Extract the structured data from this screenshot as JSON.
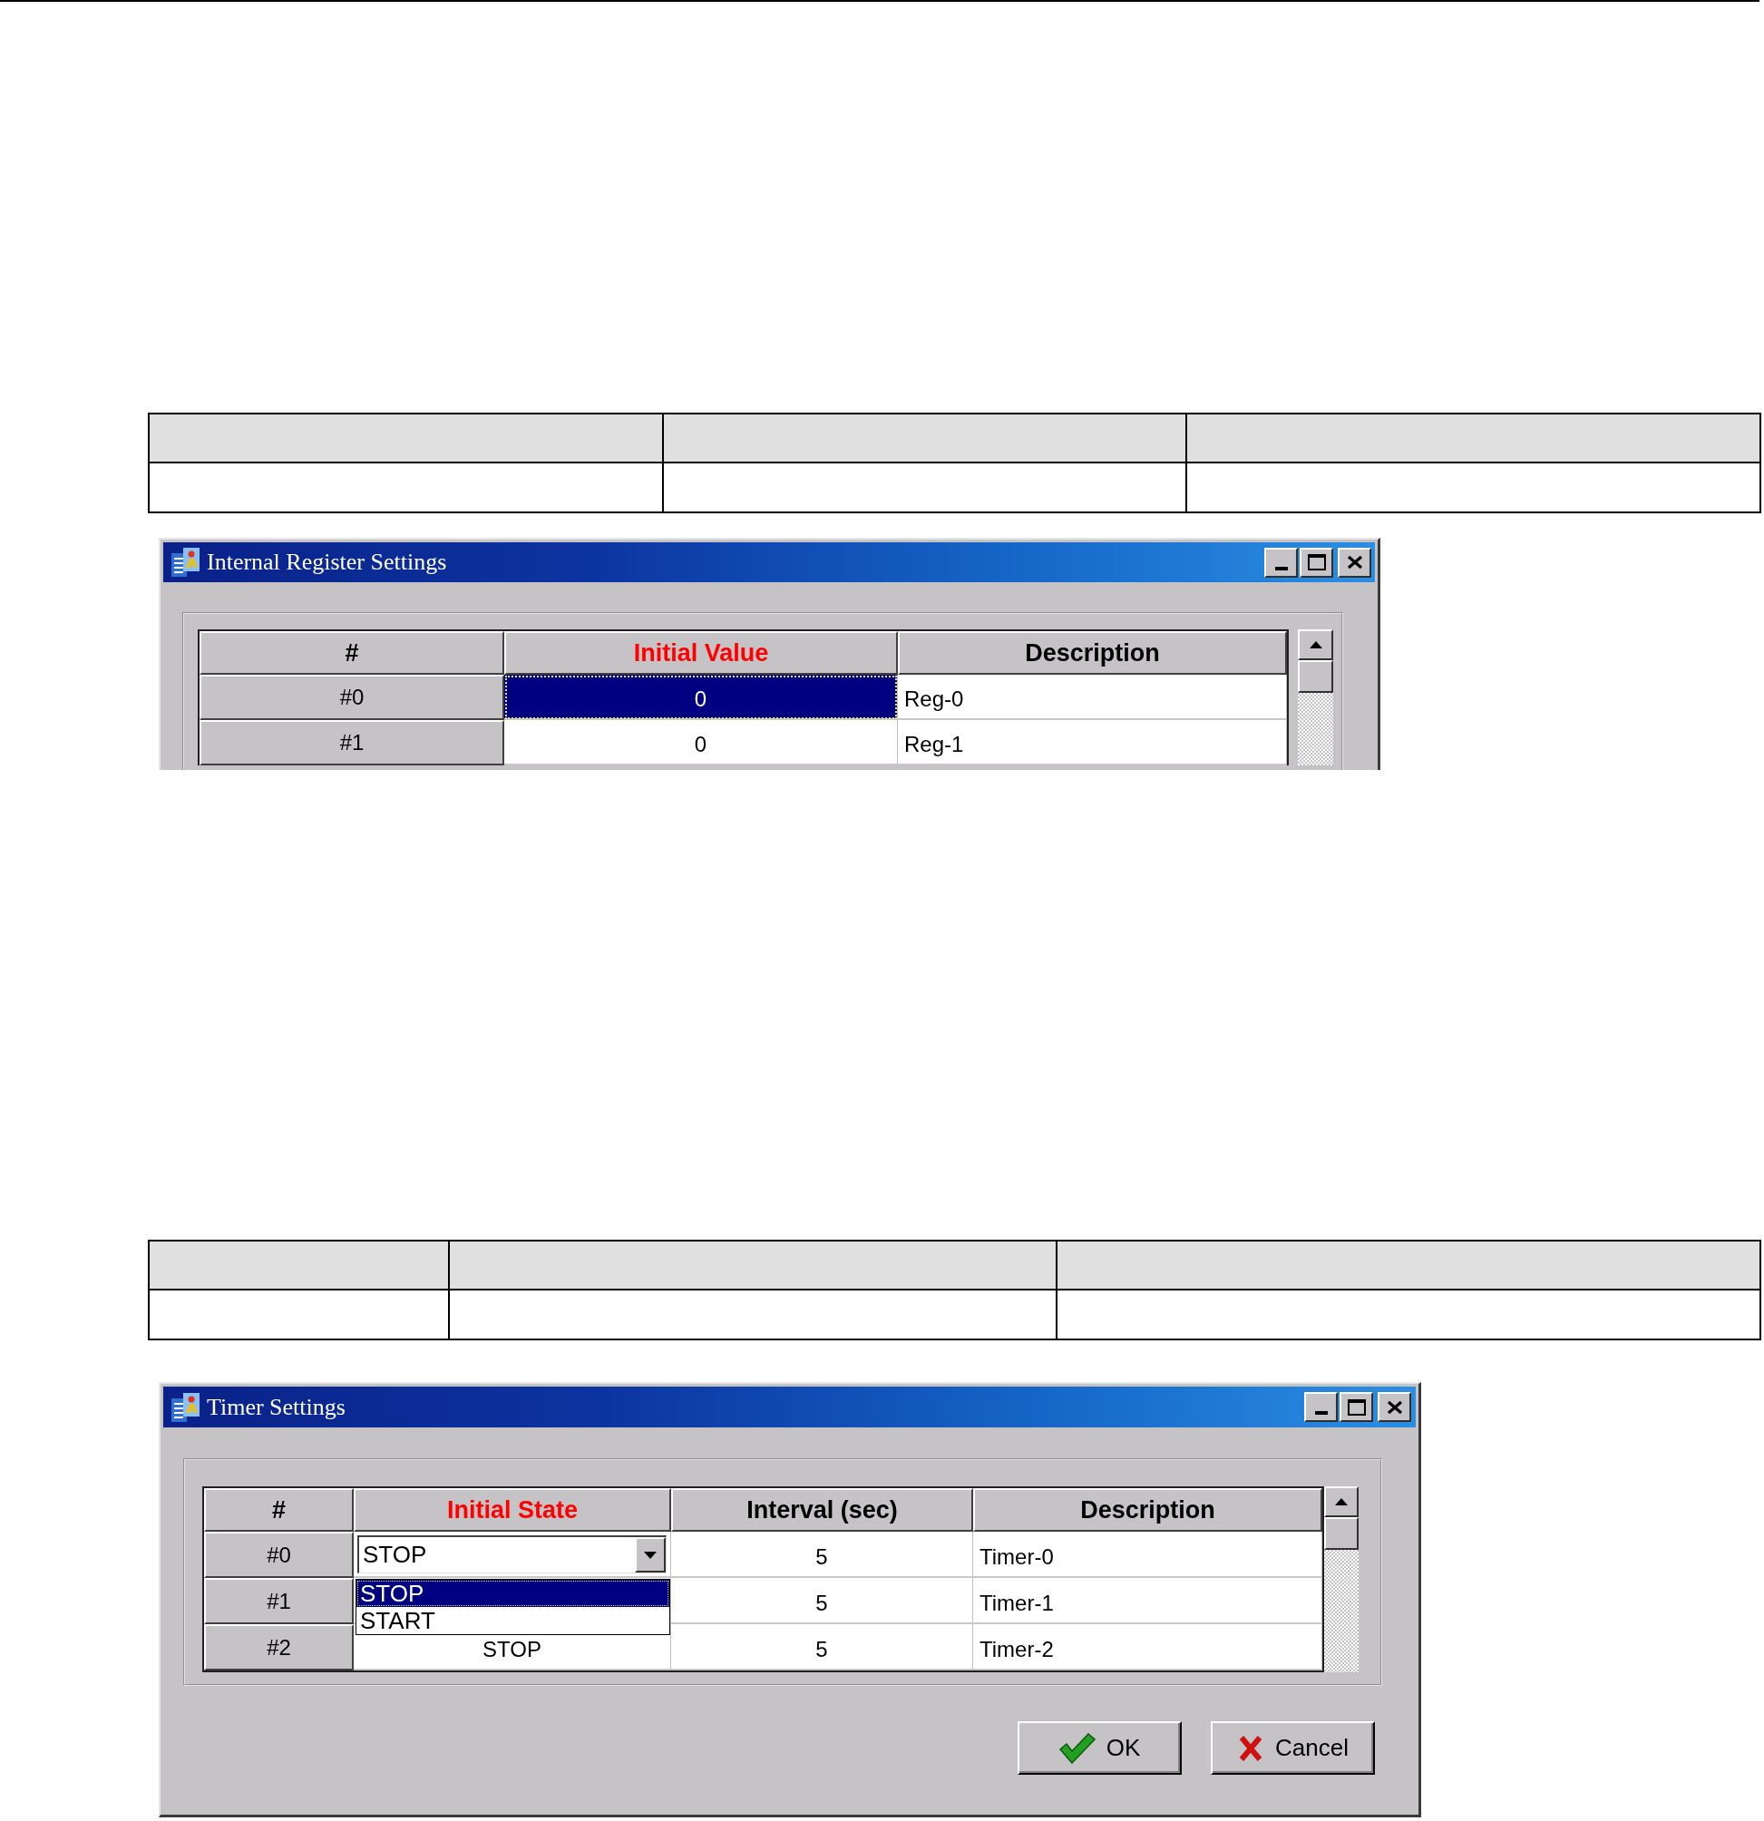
{
  "sections": [
    {
      "table": {
        "header": [
          {
            "kind": "blank"
          },
          {
            "kind": "blank"
          },
          {
            "kind": "blank"
          }
        ],
        "rows": [
          [
            {
              "kind": "blank"
            },
            {
              "kind": "blank"
            },
            {
              "kind": "blank"
            }
          ]
        ]
      },
      "dialog": {
        "title": "Internal Register Settings",
        "title_buttons": [
          {
            "kind": "minimize"
          },
          {
            "kind": "maximize"
          },
          {
            "kind": "close"
          }
        ],
        "grid": {
          "columns": [
            {
              "label": "#",
              "active": false
            },
            {
              "label": "Initial Value",
              "active": true
            },
            {
              "label": "Description",
              "active": false
            }
          ],
          "rows": [
            {
              "cells": [
                {
                  "kind": "header",
                  "text": "#0",
                  "selected": false
                },
                {
                  "kind": "value",
                  "text": "0",
                  "selected": true
                },
                {
                  "kind": "text",
                  "text": "Reg-0",
                  "selected": false
                }
              ]
            },
            {
              "cells": [
                {
                  "kind": "header",
                  "text": "#1",
                  "selected": false
                },
                {
                  "kind": "value",
                  "text": "0",
                  "selected": false
                },
                {
                  "kind": "text",
                  "text": "Reg-1",
                  "selected": false
                }
              ]
            }
          ]
        }
      }
    },
    {
      "table": {
        "header": [
          {
            "kind": "blank"
          },
          {
            "kind": "blank"
          },
          {
            "kind": "blank"
          }
        ],
        "rows": [
          [
            {
              "kind": "blank"
            },
            {
              "kind": "blank"
            },
            {
              "kind": "blank"
            }
          ]
        ]
      },
      "dialog": {
        "title": "Timer Settings",
        "title_buttons": [
          {
            "kind": "minimize"
          },
          {
            "kind": "maximize"
          },
          {
            "kind": "close"
          }
        ],
        "grid": {
          "columns": [
            {
              "label": "#",
              "active": false
            },
            {
              "label": "Initial State",
              "active": true
            },
            {
              "label": "Interval (sec)",
              "active": false
            },
            {
              "label": "Description",
              "active": false
            }
          ],
          "rows": [
            {
              "cells": [
                {
                  "kind": "header",
                  "text": "#0",
                  "selected": false
                },
                {
                  "kind": "combo",
                  "text": "STOP",
                  "selected": false,
                  "open": true,
                  "options": [
                    {
                      "label": "STOP",
                      "selected": true
                    },
                    {
                      "label": "START",
                      "selected": false
                    }
                  ]
                },
                {
                  "kind": "value",
                  "text": "5",
                  "selected": false
                },
                {
                  "kind": "text",
                  "text": "Timer-0",
                  "selected": false
                }
              ]
            },
            {
              "cells": [
                {
                  "kind": "header",
                  "text": "#1",
                  "selected": false
                },
                {
                  "kind": "blank"
                },
                {
                  "kind": "value",
                  "text": "5",
                  "selected": false
                },
                {
                  "kind": "text",
                  "text": "Timer-1",
                  "selected": false
                }
              ]
            },
            {
              "cells": [
                {
                  "kind": "header",
                  "text": "#2",
                  "selected": false
                },
                {
                  "kind": "value",
                  "text": "STOP",
                  "selected": false
                },
                {
                  "kind": "value",
                  "text": "5",
                  "selected": false
                },
                {
                  "kind": "text",
                  "text": "Timer-2",
                  "selected": false
                }
              ]
            }
          ]
        },
        "buttons": [
          {
            "kind": "ok",
            "label": "OK"
          },
          {
            "kind": "cancel",
            "label": "Cancel"
          }
        ]
      }
    }
  ]
}
